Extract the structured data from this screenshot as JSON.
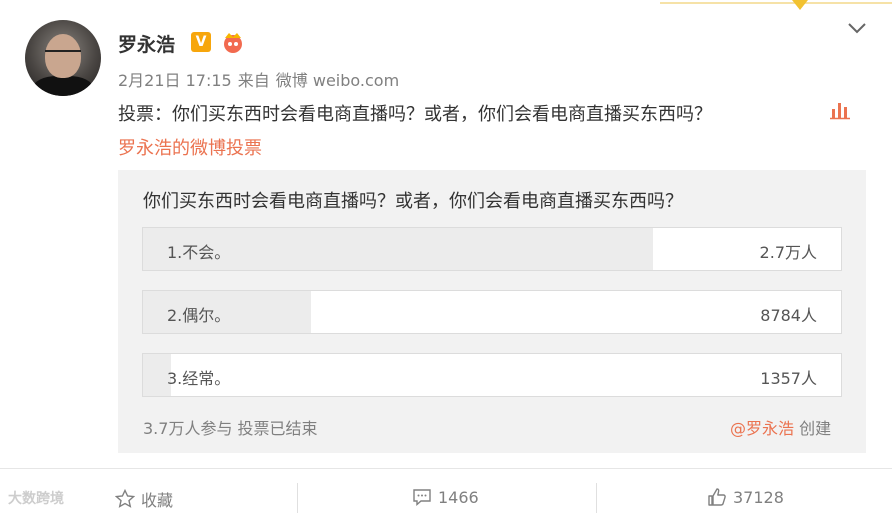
{
  "post": {
    "author": "罗永浩",
    "verified_badge": "V",
    "date": "2月21日 17:15",
    "source_prefix": "来自",
    "source": "微博 weibo.com",
    "text": "投票：你们买东西时会看电商直播吗？或者，你们会看电商直播买东西吗？",
    "vote_link": "罗永浩的微博投票"
  },
  "poll": {
    "question": "你们买东西时会看电商直播吗？或者，你们会看电商直播买东西吗？",
    "options": [
      {
        "label": "1.不会。",
        "count": "2.7万人",
        "share": 0.73
      },
      {
        "label": "2.偶尔。",
        "count": "8784人",
        "share": 0.24
      },
      {
        "label": "3.经常。",
        "count": "1357人",
        "share": 0.04
      }
    ],
    "participants": "3.7万人参与",
    "status": "投票已结束",
    "creator": "@罗永浩",
    "creator_suffix": "创建"
  },
  "actions": {
    "favorite": "收藏",
    "comments": "1466",
    "likes": "37128"
  },
  "watermark": "大数跨境",
  "colors": {
    "accent": "#eb7350",
    "badge": "#f7a60c",
    "poll_bg": "#f2f2f2",
    "bar_fill": "#ececec"
  },
  "icons": [
    "chevron-down-icon",
    "chart-icon",
    "star-icon",
    "comment-icon",
    "thumbs-up-icon"
  ]
}
